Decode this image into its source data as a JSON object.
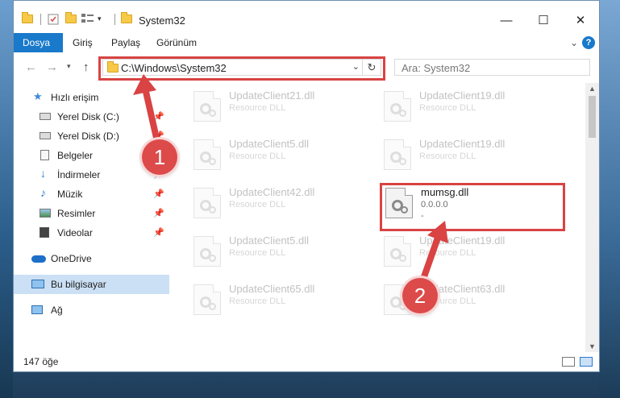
{
  "window": {
    "title": "System32",
    "controls": {
      "minimize": "—",
      "maximize": "☐",
      "close": "✕"
    }
  },
  "ribbon": {
    "tabs": [
      "Dosya",
      "Giriş",
      "Paylaş",
      "Görünüm"
    ],
    "help_label": "?",
    "collapse_glyph": "⌄"
  },
  "address": {
    "path": "C:\\Windows\\System32",
    "search_placeholder": "Ara: System32"
  },
  "sidebar": {
    "items": [
      {
        "label": "Hızlı erişim",
        "icon": "star-icon",
        "pinned": false
      },
      {
        "label": "Yerel Disk (C:)",
        "icon": "drive-icon",
        "pinned": true
      },
      {
        "label": "Yerel Disk (D:)",
        "icon": "drive-icon",
        "pinned": true
      },
      {
        "label": "Belgeler",
        "icon": "documents-icon",
        "pinned": true
      },
      {
        "label": "İndirmeler",
        "icon": "download-icon",
        "pinned": true
      },
      {
        "label": "Müzik",
        "icon": "music-icon",
        "pinned": true
      },
      {
        "label": "Resimler",
        "icon": "pictures-icon",
        "pinned": true
      },
      {
        "label": "Videolar",
        "icon": "video-icon",
        "pinned": true
      },
      {
        "label": "OneDrive",
        "icon": "cloud-icon",
        "pinned": false
      },
      {
        "label": "Bu bilgisayar",
        "icon": "computer-icon",
        "pinned": false,
        "selected": true
      },
      {
        "label": "Ağ",
        "icon": "network-icon",
        "pinned": false
      }
    ],
    "pin_glyph": "📌"
  },
  "files": {
    "left": [
      {
        "name": "UpdateClient21.dll",
        "type": "Resource DLL"
      },
      {
        "name": "UpdateClient5.dll",
        "type": "Resource DLL"
      },
      {
        "name": "UpdateClient42.dll",
        "type": "Resource DLL"
      },
      {
        "name": "UpdateClient5.dll",
        "type": "Resource DLL"
      },
      {
        "name": "UpdateClient65.dll",
        "type": "Resource DLL"
      }
    ],
    "right": [
      {
        "name": "UpdateClient19.dll",
        "type": "Resource DLL"
      },
      {
        "name": "UpdateClient19.dll",
        "type": "Resource DLL"
      },
      {
        "name": "mumsg.dll",
        "type": "0.0.0.0",
        "extra": "-",
        "highlight": true
      },
      {
        "name": "UpdateClient19.dll",
        "type": "Resource DLL"
      },
      {
        "name": "UpdateClient63.dll",
        "type": "Resource DLL"
      }
    ]
  },
  "status": {
    "item_count": "147 öğe"
  },
  "annotations": {
    "badge1": "1",
    "badge2": "2",
    "color": "#d94343"
  }
}
